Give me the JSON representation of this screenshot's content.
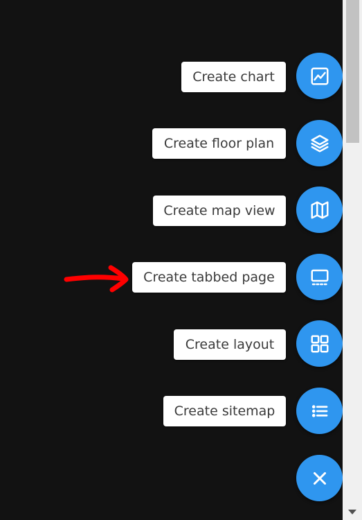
{
  "speed_dial": {
    "items": [
      {
        "label": "Create chart",
        "icon": "chart-icon"
      },
      {
        "label": "Create floor plan",
        "icon": "layers-icon"
      },
      {
        "label": "Create map view",
        "icon": "map-icon"
      },
      {
        "label": "Create tabbed page",
        "icon": "tabbed-page-icon"
      },
      {
        "label": "Create layout",
        "icon": "grid-layout-icon"
      },
      {
        "label": "Create sitemap",
        "icon": "list-icon"
      }
    ],
    "close_icon": "close-icon",
    "accent_color": "#2f96ef"
  },
  "annotation": {
    "arrow_color": "#ff0000",
    "points_to": "Create tabbed page"
  }
}
